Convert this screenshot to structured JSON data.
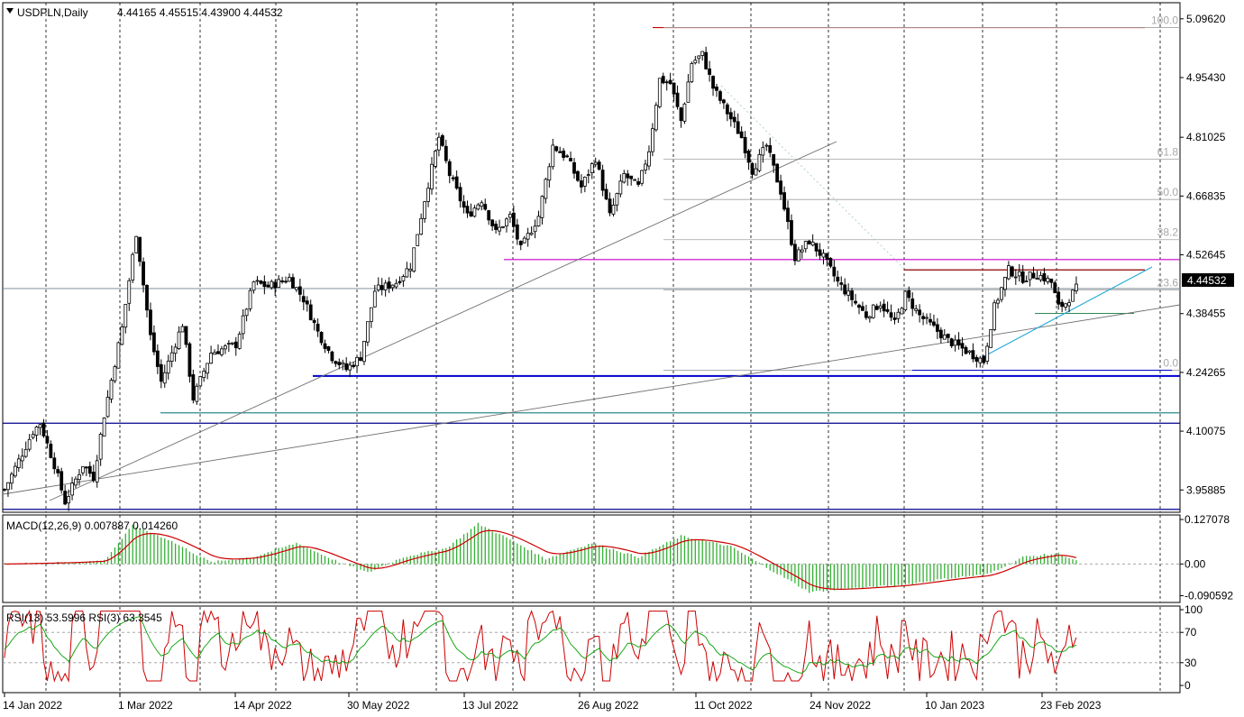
{
  "header": {
    "symbol": "USDPLN,Daily",
    "ohlc": "4.44165 4.45515 4.43900 4.44532"
  },
  "current_price_label": "4.44532",
  "chart_data": [
    {
      "type": "candlestick",
      "title": "USDPLN,Daily",
      "price_ticks": [
        "5.09620",
        "4.95430",
        "4.81025",
        "4.66835",
        "4.52645",
        "4.38455",
        "4.24265",
        "4.10075",
        "3.95885"
      ],
      "ylim": [
        3.905,
        5.135
      ],
      "date_labels": [
        "14 Jan 2022",
        "1 Mar 2022",
        "14 Apr 2022",
        "30 May 2022",
        "13 Jul 2022",
        "26 Aug 2022",
        "11 Oct 2022",
        "24 Nov 2022",
        "10 Jan 2023",
        "23 Feb 2023"
      ],
      "grid": true,
      "anchors": [
        {
          "i": 0,
          "c": 3.96
        },
        {
          "i": 8,
          "c": 4.1
        },
        {
          "i": 10,
          "c": 4.12
        },
        {
          "i": 14,
          "c": 4.02
        },
        {
          "i": 17,
          "c": 3.93
        },
        {
          "i": 22,
          "c": 4.02
        },
        {
          "i": 25,
          "c": 3.99
        },
        {
          "i": 28,
          "c": 4.14
        },
        {
          "i": 33,
          "c": 4.35
        },
        {
          "i": 37,
          "c": 4.58
        },
        {
          "i": 41,
          "c": 4.33
        },
        {
          "i": 44,
          "c": 4.22
        },
        {
          "i": 50,
          "c": 4.36
        },
        {
          "i": 53,
          "c": 4.18
        },
        {
          "i": 58,
          "c": 4.29
        },
        {
          "i": 65,
          "c": 4.31
        },
        {
          "i": 70,
          "c": 4.46
        },
        {
          "i": 74,
          "c": 4.45
        },
        {
          "i": 80,
          "c": 4.47
        },
        {
          "i": 84,
          "c": 4.42
        },
        {
          "i": 88,
          "c": 4.34
        },
        {
          "i": 92,
          "c": 4.28
        },
        {
          "i": 96,
          "c": 4.25
        },
        {
          "i": 100,
          "c": 4.28
        },
        {
          "i": 104,
          "c": 4.44
        },
        {
          "i": 110,
          "c": 4.46
        },
        {
          "i": 114,
          "c": 4.5
        },
        {
          "i": 118,
          "c": 4.66
        },
        {
          "i": 122,
          "c": 4.81
        },
        {
          "i": 125,
          "c": 4.72
        },
        {
          "i": 130,
          "c": 4.62
        },
        {
          "i": 134,
          "c": 4.66
        },
        {
          "i": 138,
          "c": 4.58
        },
        {
          "i": 142,
          "c": 4.62
        },
        {
          "i": 145,
          "c": 4.54
        },
        {
          "i": 150,
          "c": 4.62
        },
        {
          "i": 154,
          "c": 4.79
        },
        {
          "i": 158,
          "c": 4.76
        },
        {
          "i": 162,
          "c": 4.69
        },
        {
          "i": 166,
          "c": 4.76
        },
        {
          "i": 170,
          "c": 4.62
        },
        {
          "i": 174,
          "c": 4.72
        },
        {
          "i": 178,
          "c": 4.69
        },
        {
          "i": 181,
          "c": 4.78
        },
        {
          "i": 184,
          "c": 4.95
        },
        {
          "i": 187,
          "c": 4.94
        },
        {
          "i": 190,
          "c": 4.85
        },
        {
          "i": 193,
          "c": 4.99
        },
        {
          "i": 196,
          "c": 5.01
        },
        {
          "i": 199,
          "c": 4.93
        },
        {
          "i": 203,
          "c": 4.87
        },
        {
          "i": 207,
          "c": 4.81
        },
        {
          "i": 210,
          "c": 4.73
        },
        {
          "i": 214,
          "c": 4.79
        },
        {
          "i": 218,
          "c": 4.68
        },
        {
          "i": 222,
          "c": 4.52
        },
        {
          "i": 226,
          "c": 4.56
        },
        {
          "i": 230,
          "c": 4.52
        },
        {
          "i": 234,
          "c": 4.46
        },
        {
          "i": 238,
          "c": 4.42
        },
        {
          "i": 242,
          "c": 4.38
        },
        {
          "i": 246,
          "c": 4.41
        },
        {
          "i": 250,
          "c": 4.36
        },
        {
          "i": 253,
          "c": 4.43
        },
        {
          "i": 257,
          "c": 4.38
        },
        {
          "i": 261,
          "c": 4.35
        },
        {
          "i": 265,
          "c": 4.32
        },
        {
          "i": 269,
          "c": 4.3
        },
        {
          "i": 273,
          "c": 4.28
        },
        {
          "i": 275,
          "c": 4.27
        },
        {
          "i": 278,
          "c": 4.4
        },
        {
          "i": 282,
          "c": 4.49
        },
        {
          "i": 286,
          "c": 4.47
        },
        {
          "i": 290,
          "c": 4.48
        },
        {
          "i": 294,
          "c": 4.46
        },
        {
          "i": 296,
          "c": 4.4
        },
        {
          "i": 298,
          "c": 4.41
        },
        {
          "i": 301,
          "c": 4.445
        }
      ],
      "levels": [
        {
          "name": "fib-100",
          "price": 5.075,
          "color": "#cc0000"
        },
        {
          "name": "magenta-line",
          "price": 4.515,
          "color": "#cc00cc"
        },
        {
          "name": "resistance",
          "price": 4.49,
          "color": "#8b0000"
        },
        {
          "name": "support-blue",
          "price": 4.234,
          "color": "#0000cc"
        },
        {
          "name": "support-teal",
          "price": 4.145,
          "color": "#2e8b8b"
        },
        {
          "name": "low-line-1",
          "price": 4.12,
          "color": "#00008b"
        },
        {
          "name": "low-line-2",
          "price": 3.912,
          "color": "#00008b"
        }
      ],
      "fibonacci": [
        {
          "label": "100.0",
          "price": 5.075
        },
        {
          "label": "61.8",
          "price": 4.757
        },
        {
          "label": "50.0",
          "price": 4.66
        },
        {
          "label": "38.2",
          "price": 4.563
        },
        {
          "label": "23.6",
          "price": 4.442
        },
        {
          "label": "0.0",
          "price": 4.248
        }
      ]
    },
    {
      "type": "line",
      "title": "MACD(12,26,9) 0.007887 0.014260",
      "ticks": [
        "0.127078",
        "0.00",
        "-0.090592"
      ],
      "ylim": [
        -0.11,
        0.14
      ],
      "anchors": [
        {
          "i": 0,
          "v": 0.0
        },
        {
          "i": 20,
          "v": 0.005
        },
        {
          "i": 28,
          "v": 0.01
        },
        {
          "i": 36,
          "v": 0.11
        },
        {
          "i": 46,
          "v": 0.07
        },
        {
          "i": 58,
          "v": 0.005
        },
        {
          "i": 70,
          "v": 0.02
        },
        {
          "i": 82,
          "v": 0.06
        },
        {
          "i": 94,
          "v": 0.005
        },
        {
          "i": 102,
          "v": -0.025
        },
        {
          "i": 112,
          "v": 0.02
        },
        {
          "i": 124,
          "v": 0.045
        },
        {
          "i": 133,
          "v": 0.115
        },
        {
          "i": 142,
          "v": 0.07
        },
        {
          "i": 152,
          "v": 0.015
        },
        {
          "i": 165,
          "v": 0.06
        },
        {
          "i": 178,
          "v": 0.02
        },
        {
          "i": 190,
          "v": 0.08
        },
        {
          "i": 204,
          "v": 0.05
        },
        {
          "i": 214,
          "v": -0.01
        },
        {
          "i": 226,
          "v": -0.08
        },
        {
          "i": 238,
          "v": -0.07
        },
        {
          "i": 252,
          "v": -0.06
        },
        {
          "i": 266,
          "v": -0.04
        },
        {
          "i": 276,
          "v": -0.03
        },
        {
          "i": 286,
          "v": 0.02
        },
        {
          "i": 296,
          "v": 0.03
        },
        {
          "i": 301,
          "v": 0.008
        }
      ]
    },
    {
      "type": "line",
      "title": "RSI(13) 53.5996 RSI(3) 63.3545",
      "ticks": [
        "100",
        "70",
        "30",
        "0"
      ],
      "ylim": [
        0,
        100
      ],
      "series": [
        {
          "name": "RSI(13)",
          "color": "#00a000",
          "value": 53.5996
        },
        {
          "name": "RSI(3)",
          "color": "#cc0000",
          "value": 63.3545
        }
      ]
    }
  ]
}
